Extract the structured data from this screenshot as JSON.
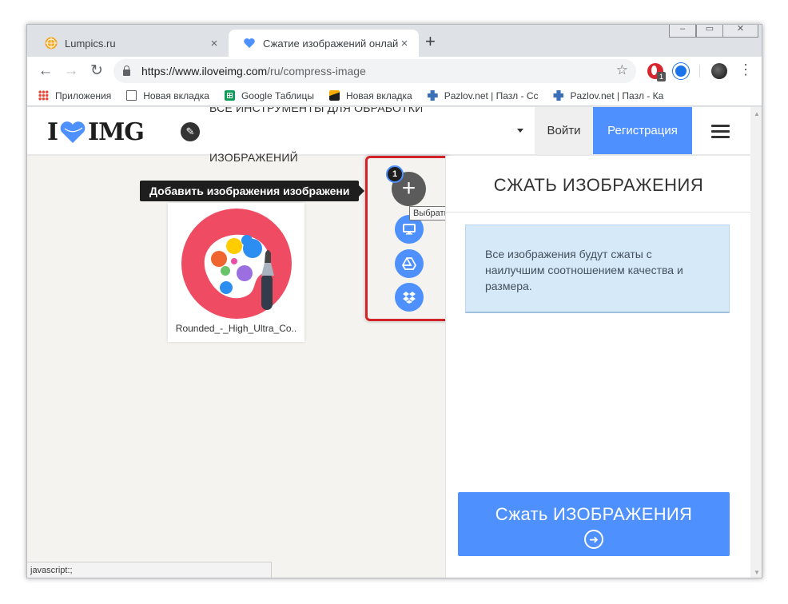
{
  "browser": {
    "tabs": [
      {
        "title": "Lumpics.ru",
        "close": "×"
      },
      {
        "title": "Сжатие изображений онлайн Н",
        "close": "×"
      }
    ],
    "new_tab": "+",
    "window_controls": [
      "–",
      "▭",
      "✕"
    ],
    "nav": {
      "back": "←",
      "forward": "→",
      "reload": "↻"
    },
    "url": {
      "host": "https://www.iloveimg.com",
      "path": "/ru/compress-image"
    },
    "star": "☆",
    "ext_badge": "1",
    "menu": "⋮",
    "bookmarks": [
      {
        "label": "Приложения",
        "icon": "apps-icon"
      },
      {
        "label": "Новая вкладка",
        "icon": "page-icon"
      },
      {
        "label": "Google Таблицы",
        "icon": "sheets-icon"
      },
      {
        "label": "Новая вкладка",
        "icon": "image-icon"
      },
      {
        "label": "Pazlov.net | Пазл - Сс",
        "icon": "puzzle-icon"
      },
      {
        "label": "Pazlov.net | Пазл - Ка",
        "icon": "puzzle-icon"
      }
    ],
    "status": "javascript:;"
  },
  "site": {
    "logo": {
      "left": "I",
      "right": "IMG"
    },
    "tools_icon": "wrench-icon",
    "nav_tools_line1": "ВСЕ ИНСТРУМЕНТЫ ДЛЯ ОБРАБОТКИ",
    "nav_tools_line2": "ИЗОБРАЖЕНИЙ",
    "login": "Войти",
    "register": "Регистрация"
  },
  "workspace": {
    "tooltip": "Добавить изображения изображени",
    "add_button": "+",
    "counter": "1",
    "hint": "Выбрать изображения",
    "sources": [
      "computer-icon",
      "google-drive-icon",
      "dropbox-icon"
    ],
    "file": {
      "name": "Rounded_-_High_Ultra_Co..",
      "thumb": "palette-icon"
    }
  },
  "sidebar": {
    "title": "СЖАТЬ ИЗОБРАЖЕНИЯ",
    "info": "Все изображения будут сжаты с наилучшим соотношением качества и размера.",
    "button": "Сжать ИЗОБРАЖЕНИЯ",
    "button_icon": "arrow-right-circle-icon"
  },
  "colors": {
    "accent": "#4d90fe",
    "highlight": "#d2232a",
    "brand_heart": "#4d90fe"
  }
}
